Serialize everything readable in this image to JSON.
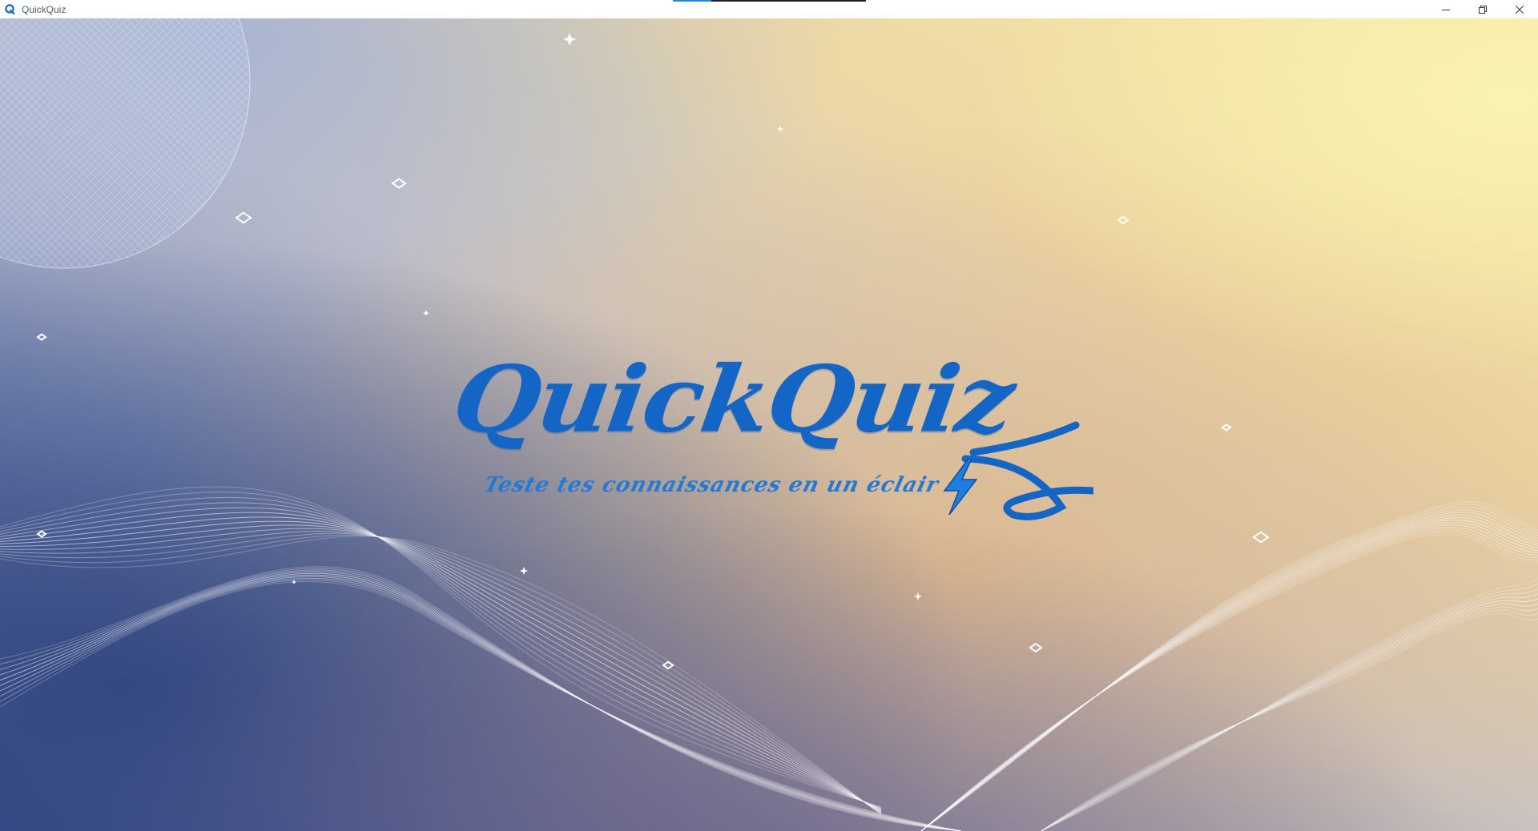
{
  "window": {
    "title": "QuickQuiz",
    "icon": "quickquiz-q-icon",
    "loading_progress": 0.2
  },
  "window_controls": {
    "minimize_icon": "minimize-icon",
    "restore_icon": "restore-icon",
    "close_icon": "close-icon"
  },
  "splash": {
    "title": "QuickQuiz",
    "tagline": "Teste tes connaissances en un éclair",
    "logo_icon": "lightning-bolt-icon"
  },
  "colors": {
    "brand_blue": "#1466c6",
    "tagline_blue": "#2279d6",
    "bg_navy": "#3b4f8c",
    "bg_gold": "#f3d68f"
  }
}
